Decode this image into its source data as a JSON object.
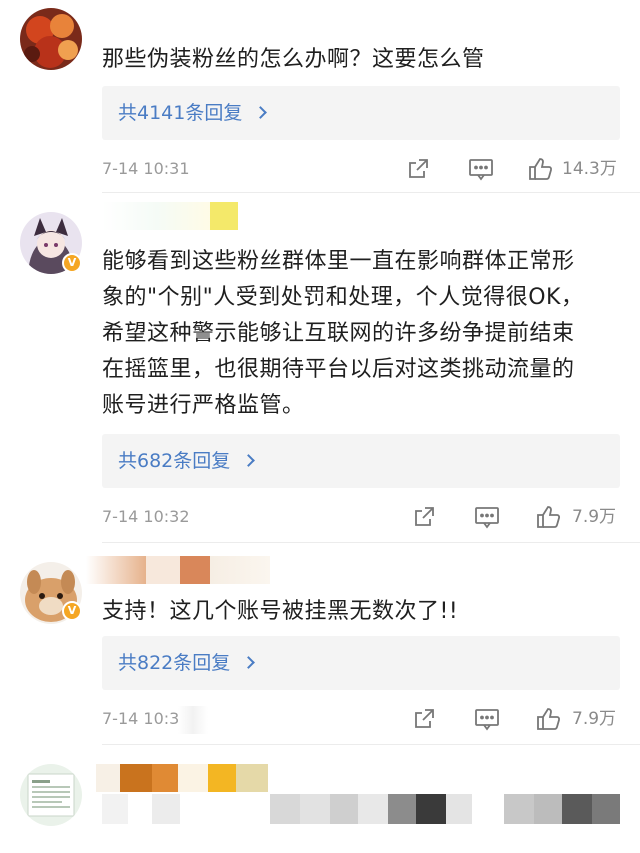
{
  "comments": [
    {
      "text": "那些伪装粉丝的怎么办啊？这要怎么管",
      "replies": "共4141条回复",
      "time": "7-14 10:31",
      "likes": "14.3万"
    },
    {
      "text_lines": [
        "能够看到这些粉丝群体里一直在影响群体正常形",
        "象的\"个别\"人受到处罚和处理，个人觉得很OK，",
        "希望这种警示能够让互联网的许多纷争提前结束",
        "在摇篮里，也很期待平台以后对这类挑动流量的",
        "账号进行严格监管。"
      ],
      "replies": "共682条回复",
      "time": "7-14 10:32",
      "likes": "7.9万"
    },
    {
      "text": "支持！这几个账号被挂黑无数次了!!",
      "replies": "共822条回复",
      "time": "7-14 10:31",
      "likes": "7.9万"
    }
  ],
  "colors": {
    "link": "#4a7cc4",
    "verified_badge": "#f5a623",
    "reply_bg": "#f4f4f4",
    "meta_text": "#9a9a9a"
  },
  "icons": [
    "share-icon",
    "comment-icon",
    "like-icon",
    "verified-badge-icon"
  ]
}
